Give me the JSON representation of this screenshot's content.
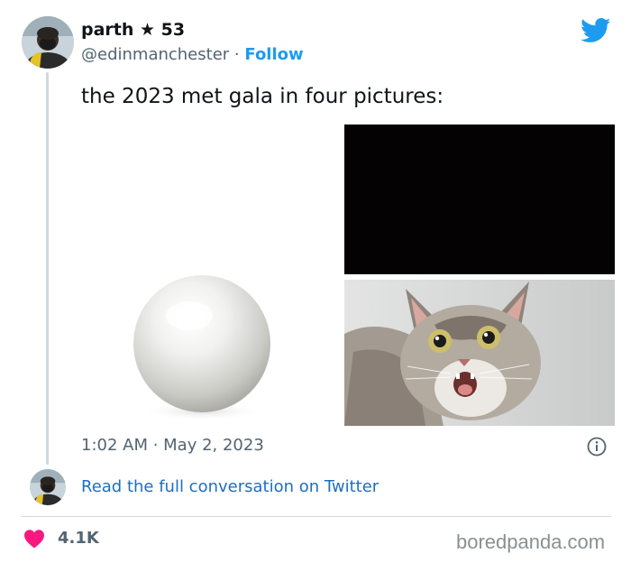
{
  "tweet": {
    "display_name": "parth",
    "name_badge": "★ 53",
    "handle": "@edinmanchester",
    "separator": "·",
    "follow_label": "Follow",
    "text": "the 2023 met gala in four pictures:",
    "timestamp": "1:02 AM · May 2, 2023"
  },
  "media": [
    {
      "description": "pearl",
      "icon": "pearl-image"
    },
    {
      "description": "black rectangle",
      "icon": "black-image"
    },
    {
      "description": "surprised cat",
      "icon": "cat-image"
    }
  ],
  "footer": {
    "read_full_label": "Read the full conversation on Twitter",
    "likes_count": "4.1K"
  },
  "watermark": "boredpanda.com",
  "colors": {
    "twitter_blue": "#1d9bf0",
    "link_blue": "#1d6fbf",
    "heart_red": "#f91880",
    "muted_text": "#536471",
    "thread_line": "#cfd9de"
  }
}
